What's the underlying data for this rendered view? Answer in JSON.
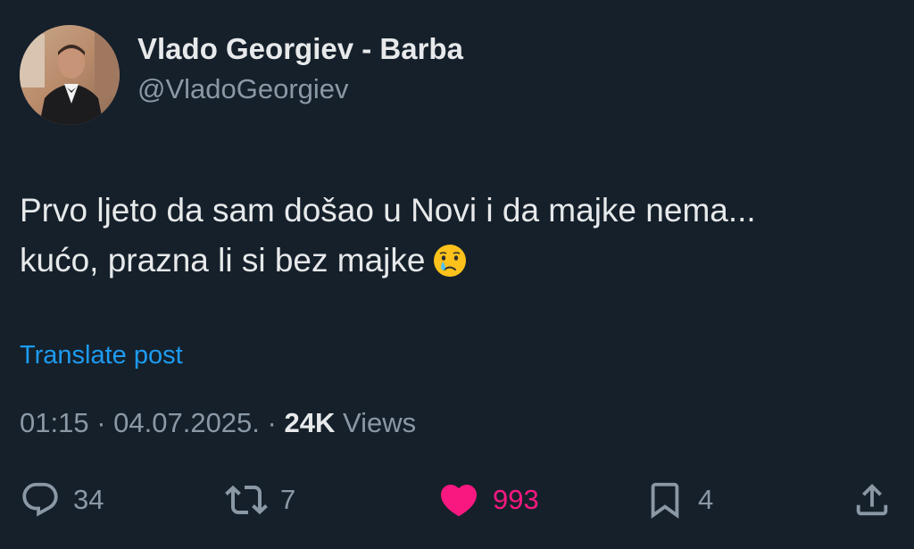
{
  "author": {
    "display_name": "Vlado Georgiev - Barba",
    "handle": "@VladoGeorgiev",
    "avatar": "profile-photo"
  },
  "post": {
    "line1": "Prvo ljeto da sam došao u Novi i da majke nema...",
    "line2": "kućo, prazna li si bez majke",
    "emoji": "crying-face-emoji"
  },
  "translate_label": "Translate post",
  "meta": {
    "time": "01:15",
    "separator1": " · ",
    "date": "04.07.2025.",
    "separator2": " · ",
    "views_count": "24K",
    "views_label": " Views"
  },
  "actions": {
    "replies": "34",
    "reposts": "7",
    "likes": "993",
    "bookmarks": "4"
  },
  "colors": {
    "background": "#15202b",
    "text": "#e7e9ea",
    "secondary": "#8b98a5",
    "link": "#1d9bf0",
    "like": "#f91880"
  }
}
